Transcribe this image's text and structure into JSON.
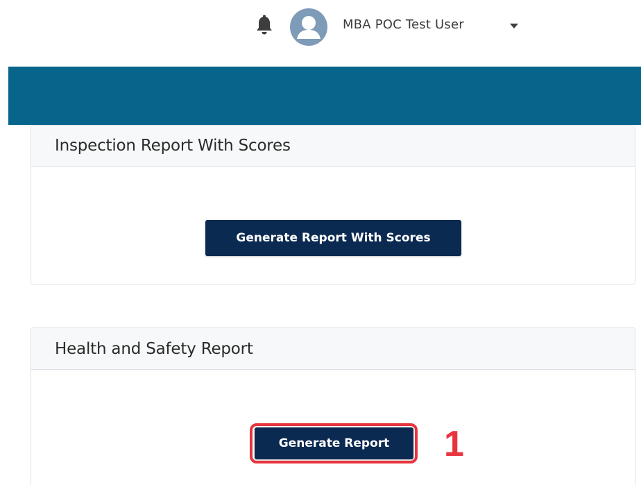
{
  "header": {
    "notification_icon": "bell-icon",
    "avatar_icon": "user-avatar-icon",
    "user_name": "MBA POC Test User",
    "user_menu_icon": "caret-down-icon"
  },
  "colors": {
    "nav_band": "#07658b",
    "button_bg": "#0b2a52",
    "annotation": "#e8343d",
    "avatar_bg": "#7e9bb8"
  },
  "cards": [
    {
      "title": "Inspection Report With Scores",
      "button_label": "Generate Report With Scores"
    },
    {
      "title": "Health and Safety Report",
      "button_label": "Generate Report"
    }
  ],
  "annotation": {
    "step_label": "1"
  }
}
